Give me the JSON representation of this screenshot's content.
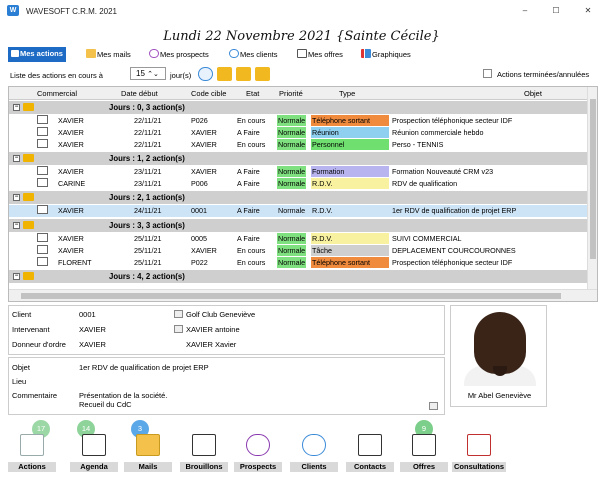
{
  "window": {
    "title": "WAVESOFT C.R.M. 2021",
    "app_icon": "app-icon",
    "minimize": "–",
    "maximize": "☐",
    "close": "✕"
  },
  "header": {
    "date_title": "Lundi 22 Novembre 2021   {Sainte Cécile}"
  },
  "tabs": [
    {
      "label": "Mes actions",
      "icon": "actions-icon",
      "active": true
    },
    {
      "label": "Mes mails",
      "icon": "mail-icon"
    },
    {
      "label": "Mes prospects",
      "icon": "prospect-icon"
    },
    {
      "label": "Mes clients",
      "icon": "client-icon"
    },
    {
      "label": "Mes offres",
      "icon": "offer-icon"
    },
    {
      "label": "Graphiques",
      "icon": "chart-icon"
    }
  ],
  "filter": {
    "label": "Liste des actions en cours à",
    "days_value": "15",
    "days_suffix": "jour(s)",
    "checkbox_label": "Actions terminées/annulées"
  },
  "grid": {
    "columns": [
      "Commercial",
      "Date début",
      "Code cible",
      "Etat",
      "Priorité",
      "Type",
      "Objet"
    ],
    "groups": [
      {
        "label": "Jours : 0, 3 action(s)",
        "rows": [
          {
            "commercial": "XAVIER",
            "date": "22/11/21",
            "code": "P026",
            "etat": "En cours",
            "priorite": "Normale",
            "type": "Téléphone sortant",
            "objet": "Prospection téléphonique secteur IDF",
            "typecolor": "#f08a3c"
          },
          {
            "commercial": "XAVIER",
            "date": "22/11/21",
            "code": "XAVIER",
            "etat": "A Faire",
            "priorite": "Normale",
            "type": "Réunion",
            "objet": "Réunion commerciale hebdo",
            "typecolor": "#8fd0f0"
          },
          {
            "commercial": "XAVIER",
            "date": "22/11/21",
            "code": "XAVIER",
            "etat": "En cours",
            "priorite": "Normale",
            "type": "Personnel",
            "objet": "Perso - TENNIS",
            "typecolor": "#6fe06f"
          }
        ]
      },
      {
        "label": "Jours : 1, 2 action(s)",
        "rows": [
          {
            "commercial": "XAVIER",
            "date": "23/11/21",
            "code": "XAVIER",
            "etat": "A Faire",
            "priorite": "Normale",
            "type": "Formation",
            "objet": "Formation Nouveauté CRM v23",
            "typecolor": "#b8b4f0"
          },
          {
            "commercial": "CARINE",
            "date": "23/11/21",
            "code": "P006",
            "etat": "A Faire",
            "priorite": "Normale",
            "type": "R.D.V.",
            "objet": "RDV de qualification",
            "typecolor": "#f8f2a0"
          }
        ]
      },
      {
        "label": "Jours : 2, 1 action(s)",
        "rows": [
          {
            "commercial": "XAVIER",
            "date": "24/11/21",
            "code": "0001",
            "etat": "A Faire",
            "priorite": "Normale",
            "type": "R.D.V.",
            "objet": "1er RDV de qualification de projet ERP",
            "typecolor": "",
            "selected": true
          }
        ]
      },
      {
        "label": "Jours : 3, 3 action(s)",
        "rows": [
          {
            "commercial": "XAVIER",
            "date": "25/11/21",
            "code": "0005",
            "etat": "A Faire",
            "priorite": "Normale",
            "type": "R.D.V.",
            "objet": "SUIVI COMMERCIAL",
            "typecolor": "#f8f2a0"
          },
          {
            "commercial": "XAVIER",
            "date": "25/11/21",
            "code": "XAVIER",
            "etat": "En cours",
            "priorite": "Normale",
            "type": "Tâche",
            "objet": "DEPLACEMENT COURCOURONNES",
            "typecolor": "#cfcfcf"
          },
          {
            "commercial": "FLORENT",
            "date": "25/11/21",
            "code": "P022",
            "etat": "En cours",
            "priorite": "Normale",
            "type": "Téléphone sortant",
            "objet": "Prospection téléphonique secteur IDF",
            "typecolor": "#f08a3c"
          }
        ]
      },
      {
        "label": "Jours : 4, 2 action(s)",
        "rows": []
      }
    ]
  },
  "details": {
    "client_label": "Client",
    "client_value": "0001",
    "client_name": "Golf Club Geneviève",
    "intervenant_label": "Intervenant",
    "intervenant_value": "XAVIER",
    "intervenant_name": "XAVIER antoine",
    "donneur_label": "Donneur d'ordre",
    "donneur_value": "XAVIER",
    "donneur_name": "XAVIER Xavier",
    "objet_label": "Objet",
    "objet_value": "1er RDV de qualification de projet ERP",
    "lieu_label": "Lieu",
    "commentaire_label": "Commentaire",
    "commentaire_line1": "Présentation de la société.",
    "commentaire_line2": "Recueil du CdC"
  },
  "contact": {
    "name": "Mr Abel Geneviève"
  },
  "bottom_buttons": [
    {
      "label": "Actions",
      "badge": "17",
      "badge_color": "#7ccf8a"
    },
    {
      "label": "Agenda",
      "badge": "14",
      "badge_color": "#8ed39a"
    },
    {
      "label": "Mails",
      "badge": "3",
      "badge_color": "#5aa8e8"
    },
    {
      "label": "Brouillons",
      "badge": ""
    },
    {
      "label": "Prospects",
      "badge": ""
    },
    {
      "label": "Clients",
      "badge": ""
    },
    {
      "label": "Contacts",
      "badge": ""
    },
    {
      "label": "Offres",
      "badge": "9",
      "badge_color": "#7ccf8a"
    },
    {
      "label": "Consultations",
      "badge": ""
    }
  ]
}
